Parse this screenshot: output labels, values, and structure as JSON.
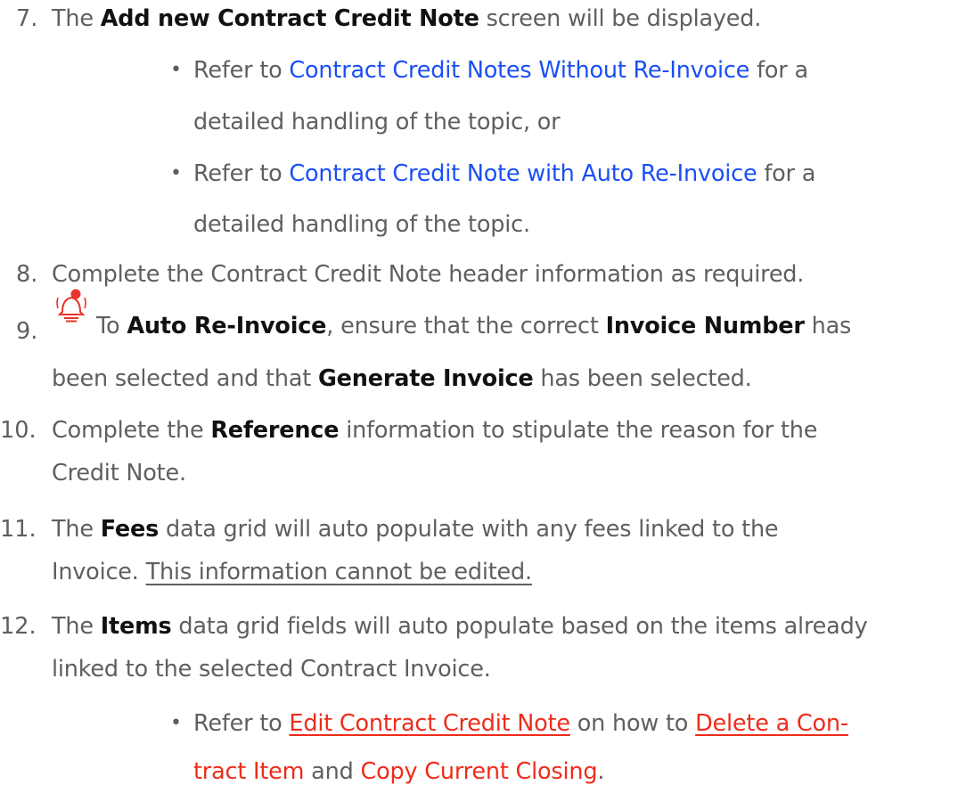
{
  "steps": [
    {
      "num": "7.",
      "parts": [
        {
          "t": "The "
        },
        {
          "b": "Add new Contract Credit Note"
        },
        {
          "t": " screen will be displayed."
        }
      ],
      "sub": [
        {
          "lines": [
            [
              {
                "t": "Refer to "
              },
              {
                "blue": "Contract Credit Notes Without Re-Invoice"
              },
              {
                "t": " for a"
              }
            ],
            [
              {
                "t": "detailed handling of the topic, or"
              }
            ]
          ]
        },
        {
          "lines": [
            [
              {
                "t": "Refer to "
              },
              {
                "blue": "Contract Credit Note with Auto Re-Invoice"
              },
              {
                "t": " for a"
              }
            ],
            [
              {
                "t": "detailed handling of the topic."
              }
            ]
          ]
        }
      ]
    },
    {
      "num": "8.",
      "parts": [
        {
          "t": "Complete the Contract Credit Note header information as required."
        }
      ]
    },
    {
      "num": "9.",
      "icon": "bell-alert-icon",
      "lines": [
        [
          {
            "t": "To "
          },
          {
            "b": "Auto Re-Invoice"
          },
          {
            "t": ", ensure that the correct "
          },
          {
            "b": "Invoice Number"
          },
          {
            "t": " has"
          }
        ],
        [
          {
            "t": "been selected and that "
          },
          {
            "b": "Generate Invoice"
          },
          {
            "t": " has been selected."
          }
        ]
      ]
    },
    {
      "num": "10.",
      "lines": [
        [
          {
            "t": "Complete the "
          },
          {
            "b": "Reference"
          },
          {
            "t": " information to stipulate the reason for the"
          }
        ],
        [
          {
            "t": "Credit Note."
          }
        ]
      ]
    },
    {
      "num": "11.",
      "lines": [
        [
          {
            "t": "The "
          },
          {
            "b": "Fees"
          },
          {
            "t": " data grid will auto populate with any fees linked to the"
          }
        ],
        [
          {
            "t": "Invoice. "
          },
          {
            "u": "This information cannot be edited."
          }
        ]
      ]
    },
    {
      "num": "12.",
      "lines": [
        [
          {
            "t": "The "
          },
          {
            "b": "Items"
          },
          {
            "t": " data grid fields will auto populate based on the items already"
          }
        ],
        [
          {
            "t": "linked to the selected Contract Invoice."
          }
        ]
      ],
      "sub": [
        {
          "lines": [
            [
              {
                "t": "Refer to "
              },
              {
                "redu": "Edit Contract Credit Note"
              },
              {
                "t": " on how to "
              },
              {
                "redu": "Delete a Con-"
              }
            ],
            [
              {
                "red": "tract Item"
              },
              {
                "t": " and "
              },
              {
                "red": "Copy Current Closing"
              },
              {
                "t": "."
              }
            ]
          ]
        }
      ]
    }
  ]
}
